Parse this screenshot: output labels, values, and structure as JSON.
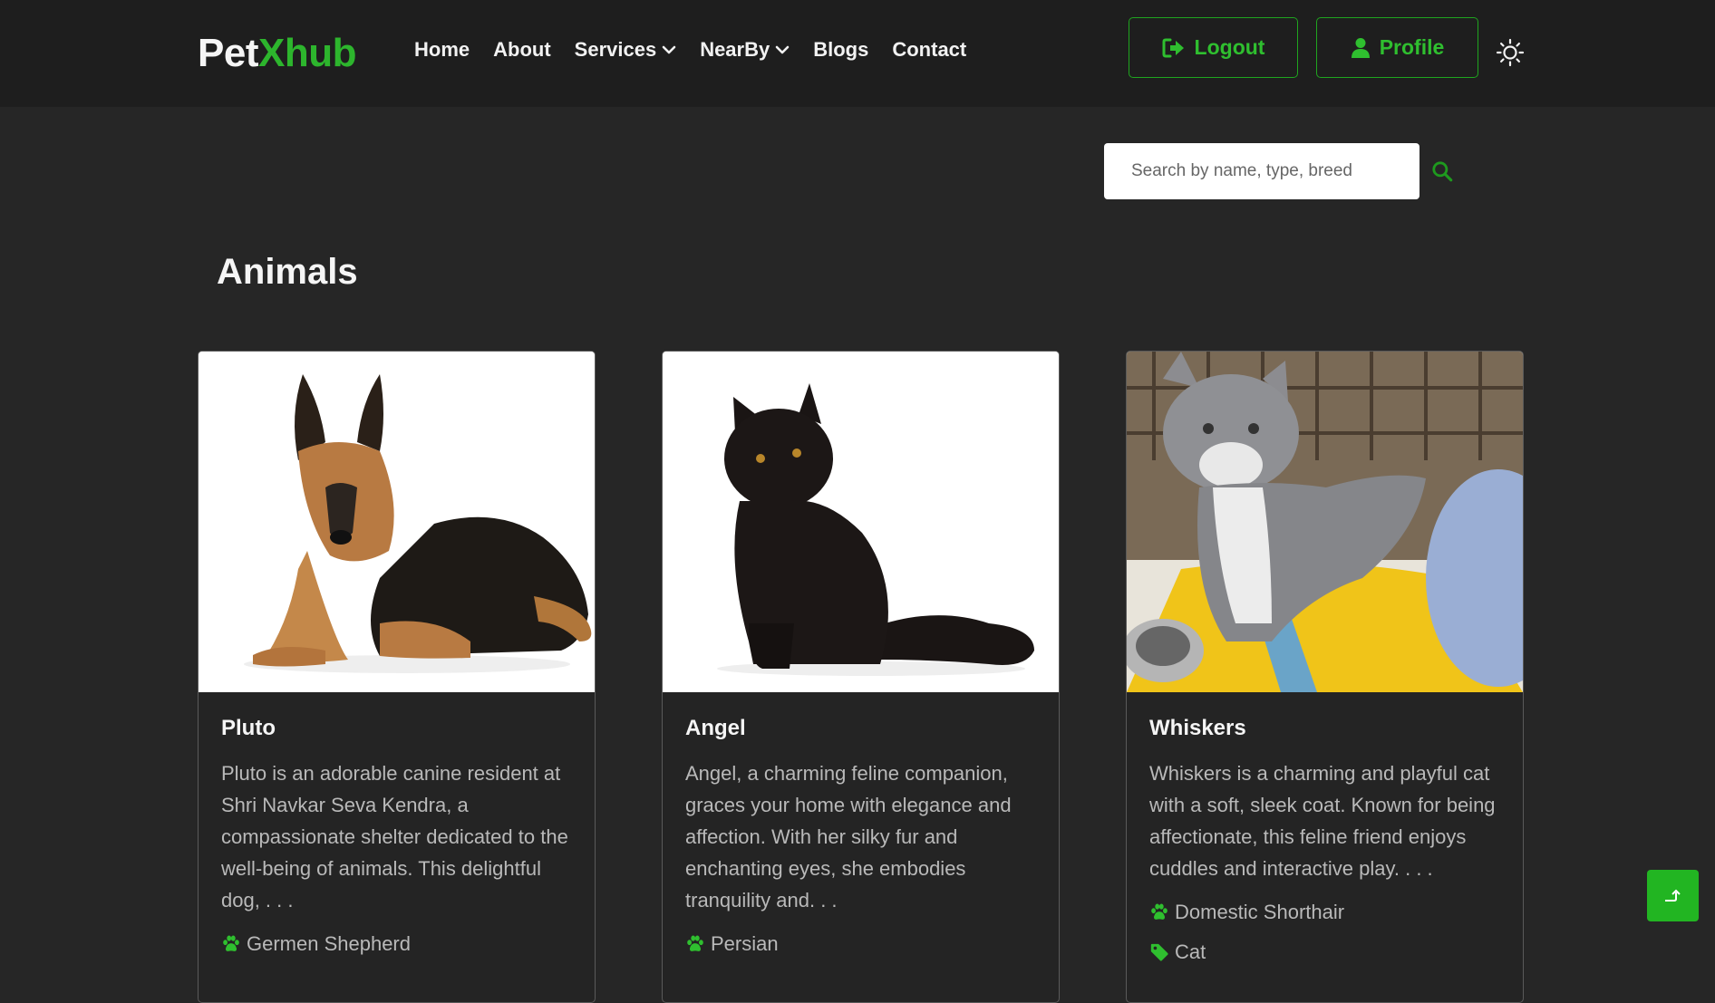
{
  "brand": {
    "part1": "Pet",
    "part2": "Xhub"
  },
  "nav": {
    "home": "Home",
    "about": "About",
    "services": "Services",
    "nearby": "NearBy",
    "blogs": "Blogs",
    "contact": "Contact"
  },
  "header": {
    "logout_label": "Logout",
    "profile_label": "Profile"
  },
  "search": {
    "placeholder": "Search by name, type, breed"
  },
  "page": {
    "title": "Animals"
  },
  "animals": [
    {
      "name": "Pluto",
      "description": "Pluto is an adorable canine resident at Shri Navkar Seva Kendra, a compassionate shelter dedicated to the well-being of animals. This delightful dog, . . .",
      "breed": "Germen Shepherd",
      "image": "german-shepherd-dog-photo"
    },
    {
      "name": "Angel",
      "description": "Angel, a charming feline companion, graces your home with elegance and affection. With her silky fur and enchanting eyes, she embodies tranquility and. . .",
      "breed": "Persian",
      "image": "black-persian-cat-photo"
    },
    {
      "name": "Whiskers",
      "description": "Whiskers is a charming and playful cat with a soft, sleek coat. Known for being affectionate, this feline friend enjoys cuddles and interactive play. . . .",
      "breed": "Domestic Shorthair",
      "type": "Cat",
      "image": "grey-kitten-photo"
    }
  ],
  "colors": {
    "accent": "#2db52d",
    "background": "#262626",
    "navbar": "#1e1e1e"
  },
  "icons": {
    "logout": "sign-out-icon",
    "profile": "user-icon",
    "theme": "sun-icon",
    "search": "search-icon",
    "breed": "paw-icon",
    "type": "tag-icon",
    "scroll": "arrow-up-icon"
  }
}
